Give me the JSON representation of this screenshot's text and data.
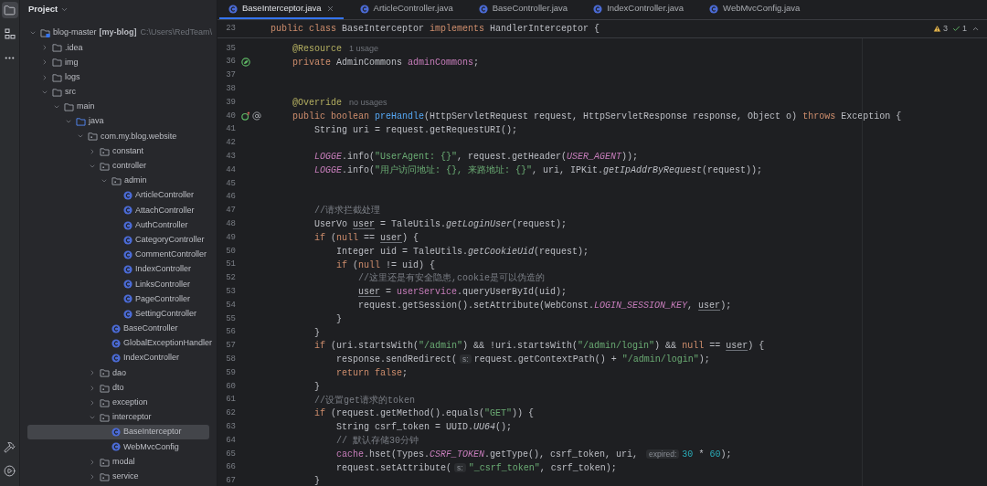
{
  "tool_strip": {
    "top": [
      {
        "kind": "project",
        "selected": true
      },
      {
        "kind": "structure",
        "selected": false
      },
      {
        "kind": "more",
        "selected": false
      }
    ],
    "bottom": [
      {
        "kind": "build",
        "selected": false
      },
      {
        "kind": "run",
        "selected": false
      }
    ]
  },
  "project": {
    "title": "Project",
    "tree": [
      {
        "label": "blog-master",
        "kind": "module",
        "module_name": "[my-blog]",
        "path": "C:\\Users\\RedTeam\\",
        "expanded": true,
        "selected": false,
        "children": [
          {
            "label": ".idea",
            "kind": "folder",
            "expanded": false,
            "selected": false
          },
          {
            "label": "img",
            "kind": "folder",
            "expanded": false,
            "selected": false
          },
          {
            "label": "logs",
            "kind": "folder",
            "expanded": false,
            "selected": false
          },
          {
            "label": "src",
            "kind": "folder",
            "expanded": true,
            "selected": false,
            "children": [
              {
                "label": "main",
                "kind": "folder",
                "expanded": true,
                "selected": false,
                "children": [
                  {
                    "label": "java",
                    "kind": "source-root",
                    "expanded": true,
                    "selected": false,
                    "children": [
                      {
                        "label": "com.my.blog.website",
                        "kind": "package",
                        "expanded": true,
                        "selected": false,
                        "children": [
                          {
                            "label": "constant",
                            "kind": "package",
                            "expanded": false,
                            "selected": false
                          },
                          {
                            "label": "controller",
                            "kind": "package",
                            "expanded": true,
                            "selected": false,
                            "children": [
                              {
                                "label": "admin",
                                "kind": "package",
                                "expanded": true,
                                "selected": false,
                                "children": [
                                  {
                                    "label": "ArticleController",
                                    "kind": "class",
                                    "selected": false
                                  },
                                  {
                                    "label": "AttachController",
                                    "kind": "class",
                                    "selected": false
                                  },
                                  {
                                    "label": "AuthController",
                                    "kind": "class",
                                    "selected": false
                                  },
                                  {
                                    "label": "CategoryController",
                                    "kind": "class",
                                    "selected": false
                                  },
                                  {
                                    "label": "CommentController",
                                    "kind": "class",
                                    "selected": false
                                  },
                                  {
                                    "label": "IndexController",
                                    "kind": "class",
                                    "selected": false
                                  },
                                  {
                                    "label": "LinksController",
                                    "kind": "class",
                                    "selected": false
                                  },
                                  {
                                    "label": "PageController",
                                    "kind": "class",
                                    "selected": false
                                  },
                                  {
                                    "label": "SettingController",
                                    "kind": "class",
                                    "selected": false
                                  }
                                ]
                              },
                              {
                                "label": "BaseController",
                                "kind": "class",
                                "selected": false
                              },
                              {
                                "label": "GlobalExceptionHandler",
                                "kind": "class",
                                "selected": false
                              },
                              {
                                "label": "IndexController",
                                "kind": "class",
                                "selected": false
                              }
                            ]
                          },
                          {
                            "label": "dao",
                            "kind": "package",
                            "expanded": false,
                            "selected": false
                          },
                          {
                            "label": "dto",
                            "kind": "package",
                            "expanded": false,
                            "selected": false
                          },
                          {
                            "label": "exception",
                            "kind": "package",
                            "expanded": false,
                            "selected": false
                          },
                          {
                            "label": "interceptor",
                            "kind": "package",
                            "expanded": true,
                            "selected": false,
                            "children": [
                              {
                                "label": "BaseInterceptor",
                                "kind": "class",
                                "selected": true
                              },
                              {
                                "label": "WebMvcConfig",
                                "kind": "class",
                                "selected": false
                              }
                            ]
                          },
                          {
                            "label": "modal",
                            "kind": "package",
                            "expanded": false,
                            "selected": false
                          },
                          {
                            "label": "service",
                            "kind": "package",
                            "expanded": false,
                            "selected": false
                          }
                        ]
                      }
                    ]
                  }
                ]
              }
            ]
          }
        ]
      }
    ]
  },
  "tabs": [
    {
      "label": "BaseInterceptor.java",
      "selected": true
    },
    {
      "label": "ArticleController.java",
      "selected": false
    },
    {
      "label": "BaseController.java",
      "selected": false
    },
    {
      "label": "IndexController.java",
      "selected": false
    },
    {
      "label": "WebMvcConfig.java",
      "selected": false
    }
  ],
  "inspections": {
    "warnings": "3",
    "passed": "1"
  },
  "sticky_line": {
    "number": "23",
    "tokens": [
      {
        "kind": "keyword",
        "text": "public class "
      },
      {
        "kind": "plain",
        "text": "BaseInterceptor "
      },
      {
        "kind": "keyword",
        "text": "implements "
      },
      {
        "kind": "plain",
        "text": "HandlerInterceptor {"
      }
    ]
  },
  "code_lines": [
    {
      "number": "35",
      "kind": "code",
      "tokens": [
        {
          "kind": "annotation",
          "text": "    @Resource"
        },
        {
          "kind": "usage-hint",
          "text": "1 usage"
        }
      ]
    },
    {
      "number": "36",
      "kind": "bean-marker",
      "tokens": [
        {
          "kind": "keyword",
          "text": "    private "
        },
        {
          "kind": "plain",
          "text": "AdminCommons "
        },
        {
          "kind": "field",
          "text": "adminCommons"
        },
        {
          "kind": "plain",
          "text": ";"
        }
      ]
    },
    {
      "number": "37",
      "kind": "code"
    },
    {
      "number": "38",
      "kind": "code"
    },
    {
      "number": "39",
      "kind": "code",
      "tokens": [
        {
          "kind": "annotation",
          "text": "    @Override"
        },
        {
          "kind": "usage-hint",
          "text": "no usages"
        }
      ]
    },
    {
      "number": "40",
      "kind": "override-marker",
      "tokens": [
        {
          "kind": "keyword",
          "text": "    public boolean "
        },
        {
          "kind": "declaration",
          "text": "preHandle"
        },
        {
          "kind": "plain",
          "text": "(HttpServletRequest request, HttpServletResponse response, Object o) "
        },
        {
          "kind": "keyword",
          "text": "throws "
        },
        {
          "kind": "plain",
          "text": "Exception {"
        }
      ]
    },
    {
      "number": "41",
      "kind": "code",
      "tokens": [
        {
          "kind": "plain",
          "text": "        String uri = request.getRequestURI();"
        }
      ]
    },
    {
      "number": "42",
      "kind": "code"
    },
    {
      "number": "43",
      "kind": "code",
      "tokens": [
        {
          "kind": "constant",
          "text": "        LOGGE"
        },
        {
          "kind": "plain",
          "text": ".info("
        },
        {
          "kind": "string",
          "text": "\"UserAgent: {}\""
        },
        {
          "kind": "plain",
          "text": ", request.getHeader("
        },
        {
          "kind": "constant",
          "text": "USER_AGENT"
        },
        {
          "kind": "plain",
          "text": "));"
        }
      ]
    },
    {
      "number": "44",
      "kind": "code",
      "tokens": [
        {
          "kind": "constant",
          "text": "        LOGGE"
        },
        {
          "kind": "plain",
          "text": ".info("
        },
        {
          "kind": "string",
          "text": "\"用户访问地址: {}, 来路地址: {}\""
        },
        {
          "kind": "plain",
          "text": ", uri, IPKit."
        },
        {
          "kind": "static-call",
          "text": "getIpAddrByRequest"
        },
        {
          "kind": "plain",
          "text": "(request));"
        }
      ]
    },
    {
      "number": "45",
      "kind": "code"
    },
    {
      "number": "46",
      "kind": "code"
    },
    {
      "number": "47",
      "kind": "code",
      "tokens": [
        {
          "kind": "comment",
          "text": "        //请求拦截处理"
        }
      ]
    },
    {
      "number": "48",
      "kind": "code",
      "tokens": [
        {
          "kind": "plain",
          "text": "        UserVo "
        },
        {
          "kind": "variable",
          "text": "user"
        },
        {
          "kind": "plain",
          "text": " = TaleUtils."
        },
        {
          "kind": "static-call",
          "text": "getLoginUser"
        },
        {
          "kind": "plain",
          "text": "(request);"
        }
      ]
    },
    {
      "number": "49",
      "kind": "code",
      "tokens": [
        {
          "kind": "keyword",
          "text": "        if "
        },
        {
          "kind": "plain",
          "text": "("
        },
        {
          "kind": "keyword",
          "text": "null"
        },
        {
          "kind": "plain",
          "text": " == "
        },
        {
          "kind": "variable",
          "text": "user"
        },
        {
          "kind": "plain",
          "text": ") {"
        }
      ]
    },
    {
      "number": "50",
      "kind": "code",
      "tokens": [
        {
          "kind": "plain",
          "text": "            Integer uid = TaleUtils."
        },
        {
          "kind": "static-call",
          "text": "getCookieUid"
        },
        {
          "kind": "plain",
          "text": "(request);"
        }
      ]
    },
    {
      "number": "51",
      "kind": "code",
      "tokens": [
        {
          "kind": "keyword",
          "text": "            if "
        },
        {
          "kind": "plain",
          "text": "("
        },
        {
          "kind": "keyword",
          "text": "null"
        },
        {
          "kind": "plain",
          "text": " != uid) {"
        }
      ]
    },
    {
      "number": "52",
      "kind": "code",
      "tokens": [
        {
          "kind": "comment",
          "text": "                //这里还是有安全隐患,cookie是可以伪造的"
        }
      ]
    },
    {
      "number": "53",
      "kind": "code",
      "tokens": [
        {
          "kind": "variable",
          "text": "                user"
        },
        {
          "kind": "plain",
          "text": " = "
        },
        {
          "kind": "field",
          "text": "userService"
        },
        {
          "kind": "plain",
          "text": ".queryUserById(uid);"
        }
      ]
    },
    {
      "number": "54",
      "kind": "code",
      "tokens": [
        {
          "kind": "plain",
          "text": "                request.getSession().setAttribute(WebConst."
        },
        {
          "kind": "constant",
          "text": "LOGIN_SESSION_KEY"
        },
        {
          "kind": "plain",
          "text": ", "
        },
        {
          "kind": "variable",
          "text": "user"
        },
        {
          "kind": "plain",
          "text": ");"
        }
      ]
    },
    {
      "number": "55",
      "kind": "code",
      "tokens": [
        {
          "kind": "plain",
          "text": "            }"
        }
      ]
    },
    {
      "number": "56",
      "kind": "code",
      "tokens": [
        {
          "kind": "plain",
          "text": "        }"
        }
      ]
    },
    {
      "number": "57",
      "kind": "code",
      "tokens": [
        {
          "kind": "keyword",
          "text": "        if "
        },
        {
          "kind": "plain",
          "text": "(uri.startsWith("
        },
        {
          "kind": "string",
          "text": "\"/admin\""
        },
        {
          "kind": "plain",
          "text": ") && !uri.startsWith("
        },
        {
          "kind": "string",
          "text": "\"/admin/login\""
        },
        {
          "kind": "plain",
          "text": ") && "
        },
        {
          "kind": "keyword",
          "text": "null"
        },
        {
          "kind": "plain",
          "text": " == "
        },
        {
          "kind": "variable",
          "text": "user"
        },
        {
          "kind": "plain",
          "text": ") {"
        }
      ]
    },
    {
      "number": "58",
      "kind": "code",
      "tokens": [
        {
          "kind": "plain",
          "text": "            response.sendRedirect("
        },
        {
          "kind": "param-hint",
          "text": "s:"
        },
        {
          "kind": "plain",
          "text": "request.getContextPath() + "
        },
        {
          "kind": "string",
          "text": "\"/admin/login\""
        },
        {
          "kind": "plain",
          "text": ");"
        }
      ]
    },
    {
      "number": "59",
      "kind": "code",
      "tokens": [
        {
          "kind": "keyword",
          "text": "            return false"
        },
        {
          "kind": "plain",
          "text": ";"
        }
      ]
    },
    {
      "number": "60",
      "kind": "code",
      "tokens": [
        {
          "kind": "plain",
          "text": "        }"
        }
      ]
    },
    {
      "number": "61",
      "kind": "code",
      "tokens": [
        {
          "kind": "comment",
          "text": "        //设置get请求的token"
        }
      ]
    },
    {
      "number": "62",
      "kind": "code",
      "tokens": [
        {
          "kind": "keyword",
          "text": "        if "
        },
        {
          "kind": "plain",
          "text": "(request.getMethod().equals("
        },
        {
          "kind": "string",
          "text": "\"GET\""
        },
        {
          "kind": "plain",
          "text": ")) {"
        }
      ]
    },
    {
      "number": "63",
      "kind": "code",
      "tokens": [
        {
          "kind": "plain",
          "text": "            String csrf_token = UUID."
        },
        {
          "kind": "static-call",
          "text": "UU64"
        },
        {
          "kind": "plain",
          "text": "();"
        }
      ]
    },
    {
      "number": "64",
      "kind": "code",
      "tokens": [
        {
          "kind": "comment",
          "text": "            // 默认存储30分钟"
        }
      ]
    },
    {
      "number": "65",
      "kind": "code",
      "tokens": [
        {
          "kind": "field",
          "text": "            cache"
        },
        {
          "kind": "plain",
          "text": ".hset(Types."
        },
        {
          "kind": "constant",
          "text": "CSRF_TOKEN"
        },
        {
          "kind": "plain",
          "text": ".getType(), csrf_token, uri, "
        },
        {
          "kind": "param-hint",
          "text": "expired:"
        },
        {
          "kind": "number",
          "text": "30"
        },
        {
          "kind": "plain",
          "text": " * "
        },
        {
          "kind": "number",
          "text": "60"
        },
        {
          "kind": "plain",
          "text": ");"
        }
      ]
    },
    {
      "number": "66",
      "kind": "code",
      "tokens": [
        {
          "kind": "plain",
          "text": "            request.setAttribute("
        },
        {
          "kind": "param-hint",
          "text": "s:"
        },
        {
          "kind": "string",
          "text": "\"_csrf_token\""
        },
        {
          "kind": "plain",
          "text": ", csrf_token);"
        }
      ]
    },
    {
      "number": "67",
      "kind": "code",
      "tokens": [
        {
          "kind": "plain",
          "text": "        }"
        }
      ]
    }
  ]
}
